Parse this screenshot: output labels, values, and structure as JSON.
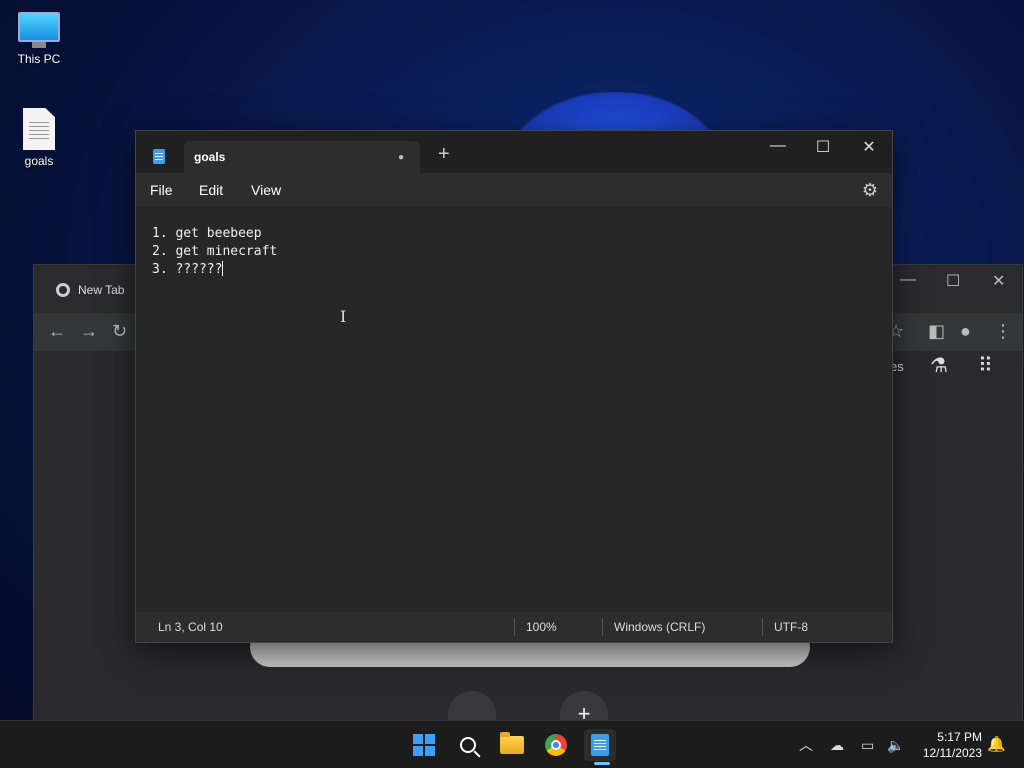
{
  "desktop": {
    "icons": [
      {
        "label": "This PC",
        "icon": "monitor-icon"
      },
      {
        "label": "goals",
        "icon": "text-file-icon"
      }
    ]
  },
  "chrome": {
    "tab_title": "New Tab",
    "partial_text": "es",
    "shortcut_add": "+"
  },
  "notepad": {
    "tab_title": "goals",
    "unsaved_indicator": "●",
    "menu": {
      "file": "File",
      "edit": "Edit",
      "view": "View"
    },
    "lines": [
      "1. get beebeep",
      "2. get minecraft",
      "3. ??????"
    ],
    "status": {
      "position": "Ln 3, Col 10",
      "zoom": "100%",
      "line_ending": "Windows (CRLF)",
      "encoding": "UTF-8"
    },
    "accent": "#3aa0e8"
  },
  "taskbar": {
    "time": "5:17 PM",
    "date": "12/11/2023",
    "accent": "#6cc4ff"
  }
}
